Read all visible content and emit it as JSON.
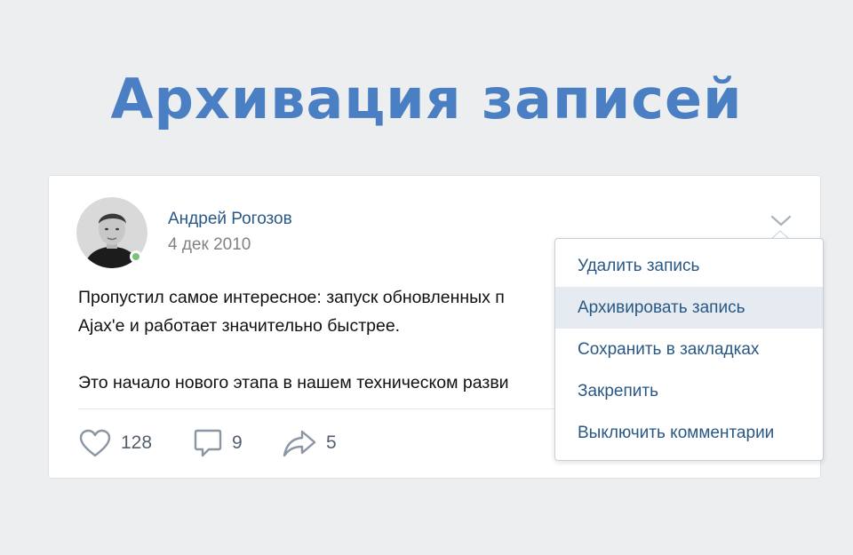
{
  "headline": "Архивация записей",
  "post": {
    "author": "Андрей Рогозов",
    "date": "4 дек 2010",
    "line1": "Пропустил самое интересное: запуск обновленных п",
    "line2": "Ajax'е и работает значительно быстрее.",
    "line3": "Это начало нового этапа в нашем техническом разви",
    "online": true
  },
  "actions": {
    "likes": "128",
    "comments": "9",
    "shares": "5"
  },
  "menu": {
    "items": [
      {
        "label": "Удалить запись",
        "active": false
      },
      {
        "label": "Архивировать запись",
        "active": true
      },
      {
        "label": "Сохранить в закладках",
        "active": false
      },
      {
        "label": "Закрепить",
        "active": false
      },
      {
        "label": "Выключить комментарии",
        "active": false
      }
    ]
  },
  "colors": {
    "accent": "#4a7fc4",
    "link": "#2a5885",
    "background": "#edeef0",
    "online": "#7ac27a",
    "menu_hover": "#e5ebf1"
  },
  "icons": [
    "heart-icon",
    "comment-icon",
    "share-icon",
    "chevron-down-icon"
  ]
}
